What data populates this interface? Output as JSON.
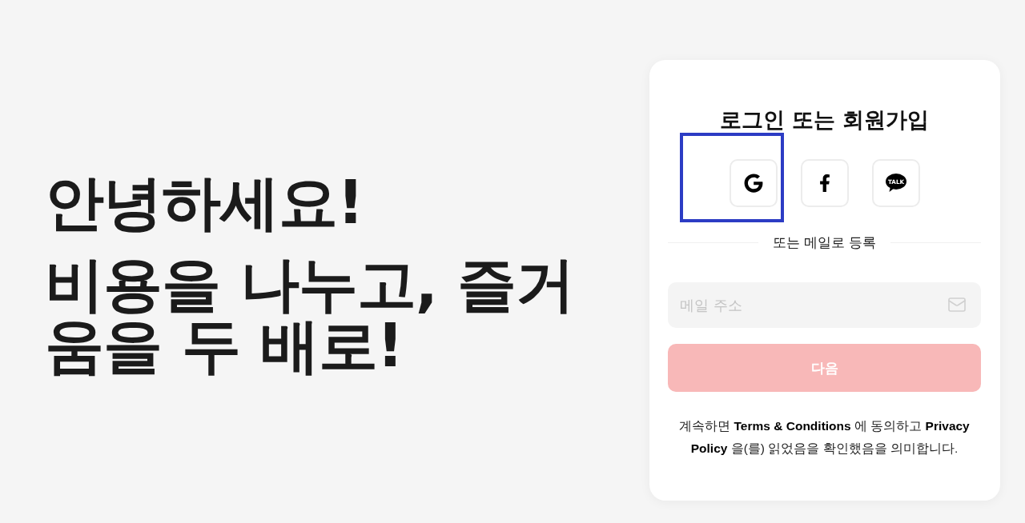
{
  "hero": {
    "greeting": "안녕하세요!",
    "tagline": "비용을 나누고, 즐거움을 두 배로!"
  },
  "login_card": {
    "title": "로그인 또는 회원가입",
    "social_buttons": [
      {
        "kind": "google",
        "focused": true
      },
      {
        "kind": "facebook",
        "focused": false
      },
      {
        "kind": "kakao",
        "icon_text": "TALK",
        "focused": false
      }
    ],
    "divider_text": "또는 메일로 등록",
    "email_field": {
      "placeholder": "메일 주소"
    },
    "next_button": {
      "label": "다음",
      "disabled": true
    },
    "terms": "계속하면 **Terms & Conditions** 에 동의하고 **Privacy Policy** 을(를) 읽었음을 확인했음을 의미합니다."
  }
}
